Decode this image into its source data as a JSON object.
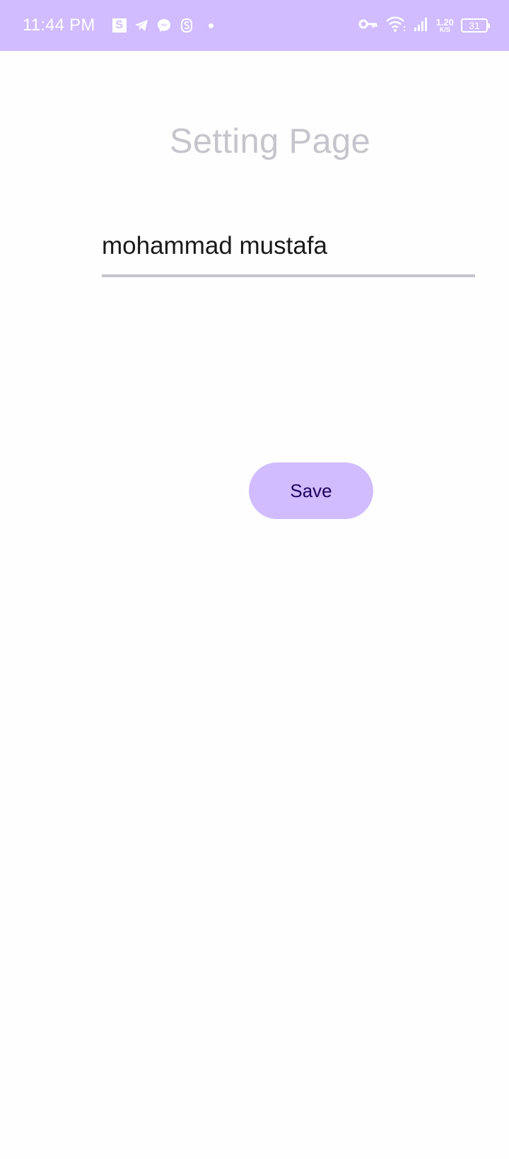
{
  "status_bar": {
    "time": "11:44 PM",
    "s_badge": "S",
    "notification_icons": [
      "s-app-icon",
      "telegram-icon",
      "messenger-icon",
      "s-logo-icon",
      "dot-icon"
    ],
    "system_icons": [
      "vpn-key-icon",
      "wifi-icon",
      "signal-icon",
      "battery-icon"
    ],
    "net_speed_value": "1.20",
    "net_speed_unit": "K/S",
    "battery_level": "31",
    "background_color": "#d0bcff"
  },
  "page": {
    "title": "Setting Page"
  },
  "name_input": {
    "value": "mohammad mustafa"
  },
  "save_button": {
    "label": "Save",
    "color": "#d0bcff",
    "text_color": "#21005d"
  }
}
